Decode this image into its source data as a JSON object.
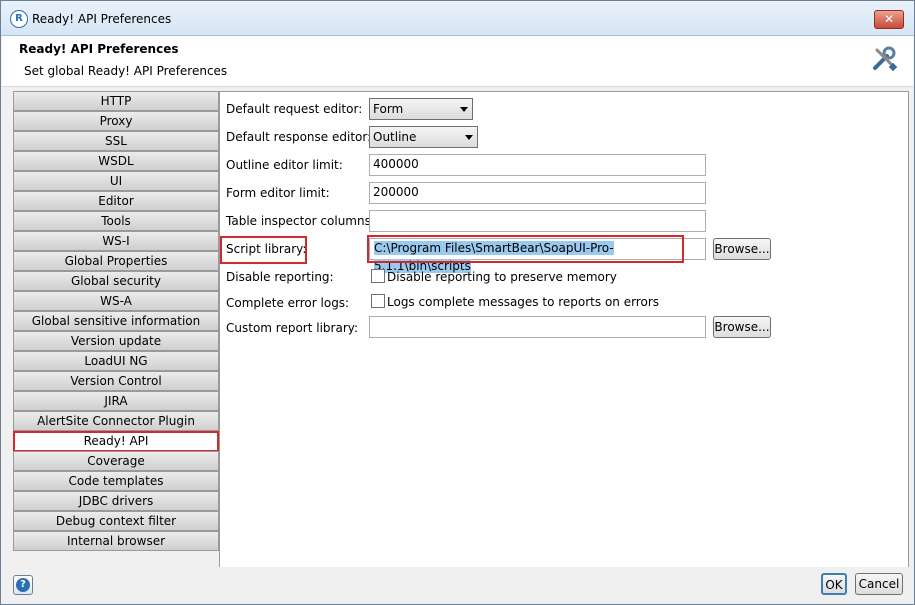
{
  "window": {
    "title": "Ready! API Preferences",
    "close_label": "✕"
  },
  "header": {
    "title": "Ready! API Preferences",
    "subtitle": "Set global Ready! API Preferences"
  },
  "sidebar": {
    "items": [
      {
        "label": "HTTP"
      },
      {
        "label": "Proxy"
      },
      {
        "label": "SSL"
      },
      {
        "label": "WSDL"
      },
      {
        "label": "UI"
      },
      {
        "label": "Editor"
      },
      {
        "label": "Tools"
      },
      {
        "label": "WS-I"
      },
      {
        "label": "Global Properties"
      },
      {
        "label": "Global security"
      },
      {
        "label": "WS-A"
      },
      {
        "label": "Global sensitive information tokens"
      },
      {
        "label": "Version update"
      },
      {
        "label": "LoadUI NG"
      },
      {
        "label": "Version Control"
      },
      {
        "label": "JIRA"
      },
      {
        "label": "AlertSite Connector Plugin"
      },
      {
        "label": "Ready! API",
        "selected": true
      },
      {
        "label": "Coverage"
      },
      {
        "label": "Code templates"
      },
      {
        "label": "JDBC drivers"
      },
      {
        "label": "Debug context filter"
      },
      {
        "label": "Internal browser"
      }
    ]
  },
  "form": {
    "default_request_editor": {
      "label": "Default request editor:",
      "value": "Form"
    },
    "default_response_editor": {
      "label": "Default response editor:",
      "value": "Outline"
    },
    "outline_editor_limit": {
      "label": "Outline editor limit:",
      "value": "400000"
    },
    "form_editor_limit": {
      "label": "Form editor limit:",
      "value": "200000"
    },
    "table_inspector_columns": {
      "label": "Table inspector columns:",
      "value": ""
    },
    "script_library": {
      "label": "Script library:",
      "value": "C:\\Program Files\\SmartBear\\SoapUI-Pro-5.1.1\\bin\\scripts",
      "browse_label": "Browse..."
    },
    "disable_reporting": {
      "label": "Disable reporting:",
      "checkbox_label": "Disable reporting to preserve memory",
      "checked": false
    },
    "complete_error_logs": {
      "label": "Complete error logs:",
      "checkbox_label": "Logs complete messages to reports on errors",
      "checked": false
    },
    "custom_report_library": {
      "label": "Custom report library:",
      "value": "",
      "browse_label": "Browse..."
    }
  },
  "footer": {
    "help_icon": "?",
    "ok_label": "OK",
    "cancel_label": "Cancel"
  },
  "colors": {
    "highlight": "#d22a2a",
    "selection": "#99c9ef"
  }
}
